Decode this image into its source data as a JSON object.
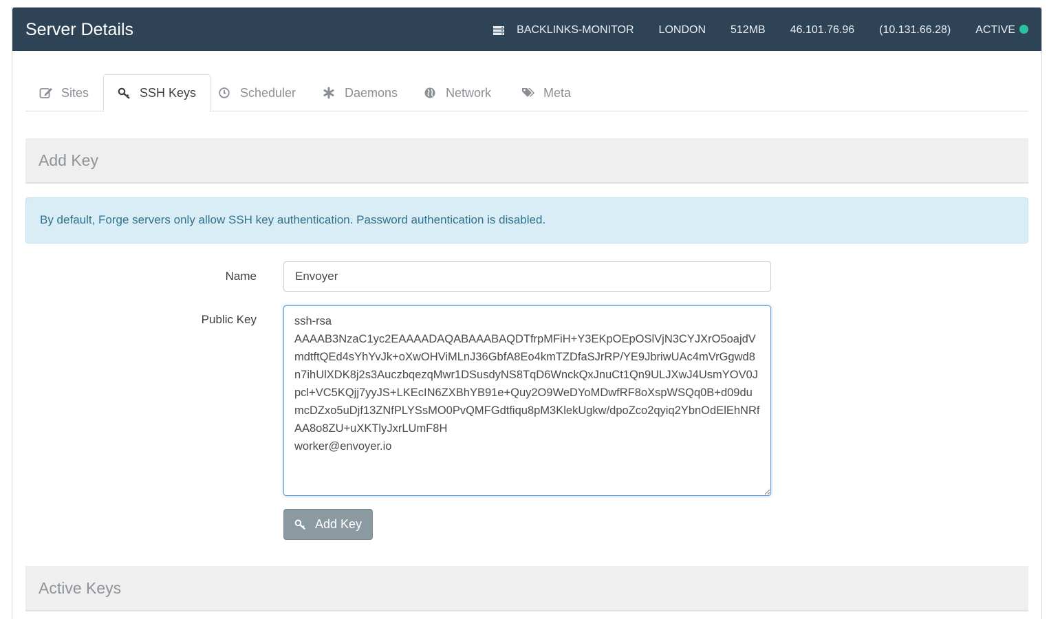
{
  "header": {
    "title": "Server Details",
    "server_name": "BACKLINKS-MONITOR",
    "region": "LONDON",
    "memory": "512MB",
    "public_ip": "46.101.76.96",
    "private_ip": "(10.131.66.28)",
    "status": "ACTIVE",
    "status_color": "#2bc2a0",
    "icons": {
      "server": "server-icon",
      "status": "status-dot"
    }
  },
  "tabs": [
    {
      "label": "Sites",
      "icon": "edit-icon",
      "active": false
    },
    {
      "label": "SSH Keys",
      "icon": "key-icon",
      "active": true
    },
    {
      "label": "Scheduler",
      "icon": "clock-icon",
      "active": false
    },
    {
      "label": "Daemons",
      "icon": "asterisk-icon",
      "active": false
    },
    {
      "label": "Network",
      "icon": "globe-icon",
      "active": false
    },
    {
      "label": "Meta",
      "icon": "tags-icon",
      "active": false
    }
  ],
  "add_key": {
    "heading": "Add Key",
    "alert": "By default, Forge servers only allow SSH key authentication. Password authentication is disabled.",
    "name_label": "Name",
    "name_value": "Envoyer",
    "public_key_label": "Public Key",
    "public_key_value": "ssh-rsa\nAAAAB3NzaC1yc2EAAAADAQABAAABAQDTfrpMFiH+Y3EKpOEpOSlVjN3CYJXrO5oajdVmdtftQEd4sYhYvJk+oXwOHViMLnJ36GbfA8Eo4kmTZDfaSJrRP/YE9JbriwUAc4mVrGgwd8n7ihUlXDK8j2s3AuczbqezqMwr1DSusdyNS8TqD6WnckQxJnuCt1Qn9ULJXwJ4UsmYOV0Jpcl+VC5KQjj7yyJS+LKEcIN6ZXBhYB91e+Quy2O9WeDYoMDwfRF8oXspWSQq0B+d09dumcDZxo5uDjf13ZNfPLYSsMO0PvQMFGdtfiqu8pM3KlekUgkw/dpoZco2qyiq2YbnOdElEhNRfAA8o8ZU+uXKTlyJxrLUmF8H\nworker@envoyer.io",
    "submit_label": "Add Key",
    "accent_color": "#5b9ddd",
    "button_color": "#8a9aa0"
  },
  "active_keys": {
    "heading": "Active Keys"
  },
  "colors": {
    "header_bg": "#2f4357",
    "info_bg": "#d9edf6",
    "info_text": "#31708f"
  }
}
